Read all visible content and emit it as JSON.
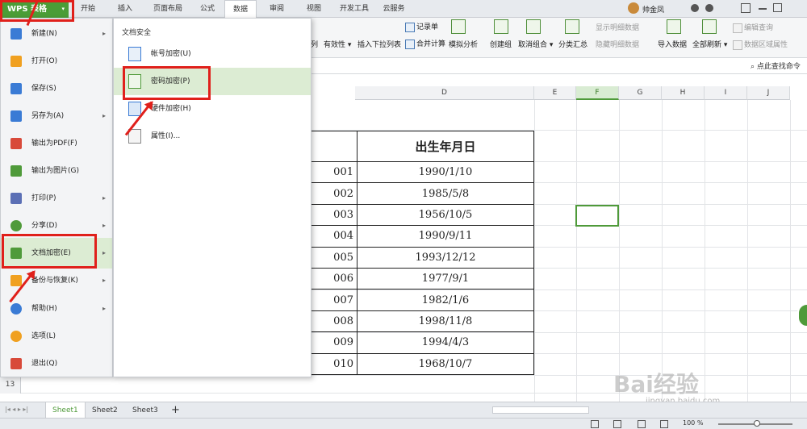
{
  "app": {
    "title": "WPS 表格",
    "dropdown_glyph": "▾"
  },
  "tabs": [
    {
      "label": "开始"
    },
    {
      "label": "插入"
    },
    {
      "label": "页面布局"
    },
    {
      "label": "公式"
    },
    {
      "label": "数据"
    },
    {
      "label": "审阅"
    },
    {
      "label": "视图"
    },
    {
      "label": "开发工具"
    },
    {
      "label": "云服务"
    }
  ],
  "user": {
    "name": "帅金凤"
  },
  "ribbon": {
    "column_partial": "列",
    "validity": "有效性",
    "dropdown_list": "插入下拉列表",
    "record_form": "记录单",
    "merge_calc": "合并计算",
    "simulate": "模拟分析",
    "create_group": "创建组",
    "ungroup": "取消组合",
    "subtotal": "分类汇总",
    "show_detail": "显示明细数据",
    "hide_detail": "隐藏明细数据",
    "import_data": "导入数据",
    "refresh_all": "全部刷新",
    "edit_query": "编辑查询",
    "range_props": "数据区域属性"
  },
  "search": {
    "label": "点此查找命令"
  },
  "columns": [
    "D",
    "E",
    "F",
    "G",
    "H",
    "I",
    "J"
  ],
  "selected_column": "F",
  "table": {
    "header": "出生年月日",
    "rows": [
      {
        "id": "001",
        "date": "1990/1/10"
      },
      {
        "id": "002",
        "date": "1985/5/8"
      },
      {
        "id": "003",
        "date": "1956/10/5"
      },
      {
        "id": "004",
        "date": "1990/9/11"
      },
      {
        "id": "005",
        "date": "1993/12/12"
      },
      {
        "id": "006",
        "date": "1977/9/1"
      },
      {
        "id": "007",
        "date": "1982/1/6"
      },
      {
        "id": "008",
        "date": "1998/11/8"
      },
      {
        "id": "009",
        "date": "1994/4/3"
      },
      {
        "id": "010",
        "date": "1968/10/7"
      }
    ]
  },
  "row_13": "13",
  "menu": {
    "items": [
      {
        "label": "新建(N)",
        "color": "#3a7bd5",
        "submenu": true
      },
      {
        "label": "打开(O)",
        "color": "#f0a020",
        "submenu": false
      },
      {
        "label": "保存(S)",
        "color": "#3a7bd5",
        "submenu": false
      },
      {
        "label": "另存为(A)",
        "color": "#3a7bd5",
        "submenu": true
      },
      {
        "label": "输出为PDF(F)",
        "color": "#d84a3a",
        "submenu": false
      },
      {
        "label": "输出为图片(G)",
        "color": "#4f9a3a",
        "submenu": false
      },
      {
        "label": "打印(P)",
        "color": "#5b6fb5",
        "submenu": true
      },
      {
        "label": "分享(D)",
        "color": "#4f9a3a",
        "submenu": true
      },
      {
        "label": "文档加密(E)",
        "color": "#4f9a3a",
        "submenu": true
      },
      {
        "label": "备份与恢复(K)",
        "color": "#f0a020",
        "submenu": true
      },
      {
        "label": "帮助(H)",
        "color": "#3a7bd5",
        "submenu": true
      },
      {
        "label": "选项(L)",
        "color": "#f0a020",
        "submenu": false
      },
      {
        "label": "退出(Q)",
        "color": "#d84a3a",
        "submenu": false
      }
    ],
    "submenu_arrow": "▸"
  },
  "submenu": {
    "title": "文档安全",
    "items": [
      {
        "label": "帐号加密(U)"
      },
      {
        "label": "密码加密(P)"
      },
      {
        "label": "硬件加密(H)"
      },
      {
        "label": "属性(I)..."
      }
    ]
  },
  "sheets": [
    {
      "label": "Sheet1"
    },
    {
      "label": "Sheet2"
    },
    {
      "label": "Sheet3"
    }
  ],
  "add_sheet": "+",
  "status": {
    "zoom": "100 %"
  },
  "watermark": {
    "brand": "Bai经验",
    "url": "jingyan.baidu.com"
  },
  "colors": {
    "accent": "#4f9a3a",
    "annotation": "#e0201b"
  }
}
